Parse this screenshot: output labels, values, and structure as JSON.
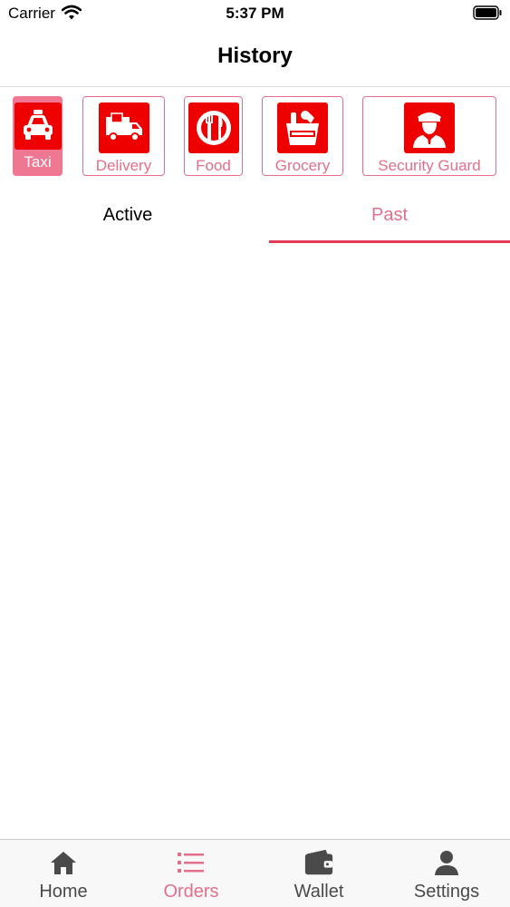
{
  "status_bar": {
    "carrier": "Carrier",
    "time": "5:37 PM"
  },
  "header": {
    "title": "History"
  },
  "categories": [
    {
      "label": "Taxi",
      "icon": "taxi-icon",
      "selected": true
    },
    {
      "label": "Delivery",
      "icon": "delivery-truck-icon",
      "selected": false
    },
    {
      "label": "Food",
      "icon": "plate-cutlery-icon",
      "selected": false
    },
    {
      "label": "Grocery",
      "icon": "grocery-bag-icon",
      "selected": false
    },
    {
      "label": "Security Guard",
      "icon": "security-guard-icon",
      "selected": false
    }
  ],
  "tabs": [
    {
      "label": "Active",
      "selected": false
    },
    {
      "label": "Past",
      "selected": true
    }
  ],
  "tab_bar": [
    {
      "label": "Home",
      "icon": "home-icon",
      "selected": false
    },
    {
      "label": "Orders",
      "icon": "list-icon",
      "selected": true
    },
    {
      "label": "Wallet",
      "icon": "wallet-icon",
      "selected": false
    },
    {
      "label": "Settings",
      "icon": "person-icon",
      "selected": false
    }
  ],
  "colors": {
    "accent": "#e46f8b",
    "accent_fill": "#f07792",
    "tab_underline": "#e23a57",
    "icon_red": "#ef0000",
    "tab_bar_inactive": "#4a4a4a"
  }
}
